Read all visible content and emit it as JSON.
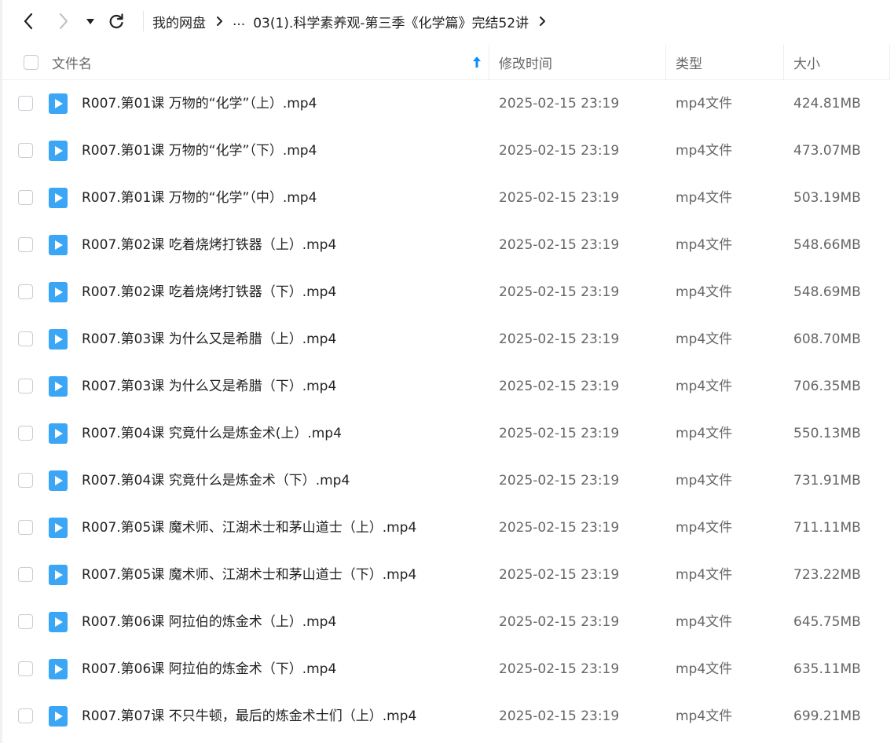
{
  "nav": {
    "back_icon": "chevron-left-icon",
    "forward_icon": "chevron-right-icon",
    "dropdown_icon": "caret-down-icon",
    "refresh_icon": "refresh-icon"
  },
  "breadcrumb": {
    "root": "我的网盘",
    "ellipsis": "...",
    "current": "03(1).科学素养观-第三季《化学篇》完结52讲"
  },
  "columns": {
    "name": "文件名",
    "modified": "修改时间",
    "type": "类型",
    "size": "大小",
    "sort_icon": "sort-arrow-up-icon"
  },
  "colors": {
    "accent": "#0a8cff",
    "file_icon": "#3aa6f5",
    "text": "#222222",
    "muted": "#666666"
  },
  "files": [
    {
      "name": "R007.第01课 万物的“化学”（上）.mp4",
      "modified": "2025-02-15 23:19",
      "type": "mp4文件",
      "size": "424.81MB"
    },
    {
      "name": "R007.第01课 万物的“化学”（下）.mp4",
      "modified": "2025-02-15 23:19",
      "type": "mp4文件",
      "size": "473.07MB"
    },
    {
      "name": "R007.第01课 万物的“化学”（中）.mp4",
      "modified": "2025-02-15 23:19",
      "type": "mp4文件",
      "size": "503.19MB"
    },
    {
      "name": "R007.第02课 吃着烧烤打铁器（上）.mp4",
      "modified": "2025-02-15 23:19",
      "type": "mp4文件",
      "size": "548.66MB"
    },
    {
      "name": "R007.第02课 吃着烧烤打铁器（下）.mp4",
      "modified": "2025-02-15 23:19",
      "type": "mp4文件",
      "size": "548.69MB"
    },
    {
      "name": "R007.第03课 为什么又是希腊（上）.mp4",
      "modified": "2025-02-15 23:19",
      "type": "mp4文件",
      "size": "608.70MB"
    },
    {
      "name": "R007.第03课 为什么又是希腊（下）.mp4",
      "modified": "2025-02-15 23:19",
      "type": "mp4文件",
      "size": "706.35MB"
    },
    {
      "name": "R007.第04课 究竟什么是炼金术(上）.mp4",
      "modified": "2025-02-15 23:19",
      "type": "mp4文件",
      "size": "550.13MB"
    },
    {
      "name": "R007.第04课 究竟什么是炼金术（下）.mp4",
      "modified": "2025-02-15 23:19",
      "type": "mp4文件",
      "size": "731.91MB"
    },
    {
      "name": "R007.第05课 魔术师、江湖术士和茅山道士（上）.mp4",
      "modified": "2025-02-15 23:19",
      "type": "mp4文件",
      "size": "711.11MB"
    },
    {
      "name": "R007.第05课 魔术师、江湖术士和茅山道士（下）.mp4",
      "modified": "2025-02-15 23:19",
      "type": "mp4文件",
      "size": "723.22MB"
    },
    {
      "name": "R007.第06课 阿拉伯的炼金术（上）.mp4",
      "modified": "2025-02-15 23:19",
      "type": "mp4文件",
      "size": "645.75MB"
    },
    {
      "name": "R007.第06课 阿拉伯的炼金术（下）.mp4",
      "modified": "2025-02-15 23:19",
      "type": "mp4文件",
      "size": "635.11MB"
    },
    {
      "name": "R007.第07课 不只牛顿，最后的炼金术士们（上）.mp4",
      "modified": "2025-02-15 23:19",
      "type": "mp4文件",
      "size": "699.21MB"
    }
  ]
}
